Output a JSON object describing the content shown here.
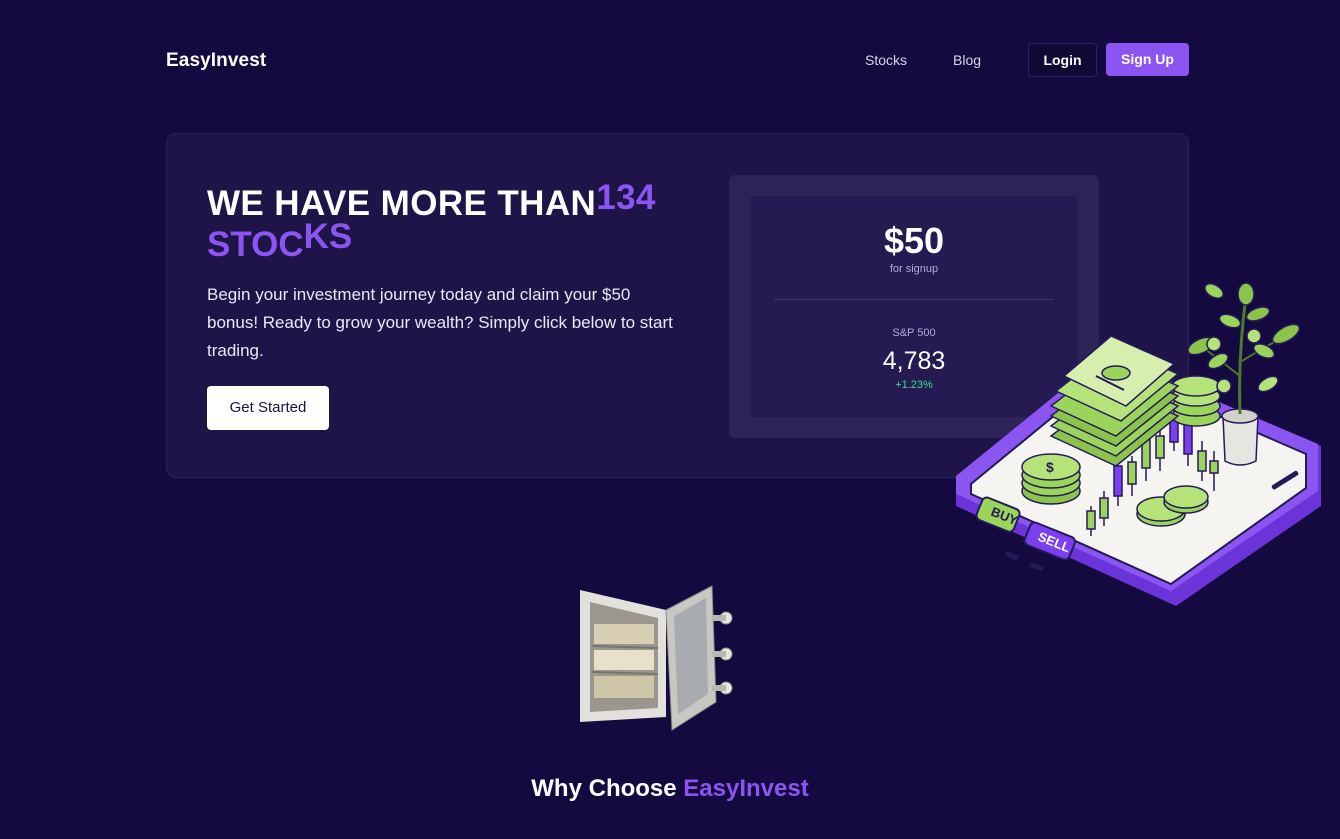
{
  "nav": {
    "brand": "EasyInvest",
    "links": [
      "Stocks",
      "Blog"
    ],
    "login_label": "Login",
    "signup_label": "Sign Up"
  },
  "hero": {
    "headline_prefix": "WE HAVE MORE THAN",
    "stock_count": "134",
    "headline_suffix_part1": "STOC",
    "headline_suffix_part2": "KS",
    "description": "Begin your investment journey today and claim your $50 bonus! Ready to grow your wealth? Simply click below to start trading.",
    "cta_label": "Get Started"
  },
  "stats": {
    "bonus_amount": "$50",
    "bonus_caption": "for signup",
    "index_name": "S&P 500",
    "index_value": "4,783",
    "index_change": "+1.23%"
  },
  "illustrations": {
    "phone_tags": [
      "BUY",
      "SELL"
    ],
    "coin_symbol": "$"
  },
  "colors": {
    "background": "#150a3f",
    "accent": "#8b55f2",
    "positive": "#3edc8f",
    "money_green": "#9bd45a"
  },
  "section": {
    "title_prefix": "Why Choose",
    "title_accent": "EasyInvest"
  }
}
